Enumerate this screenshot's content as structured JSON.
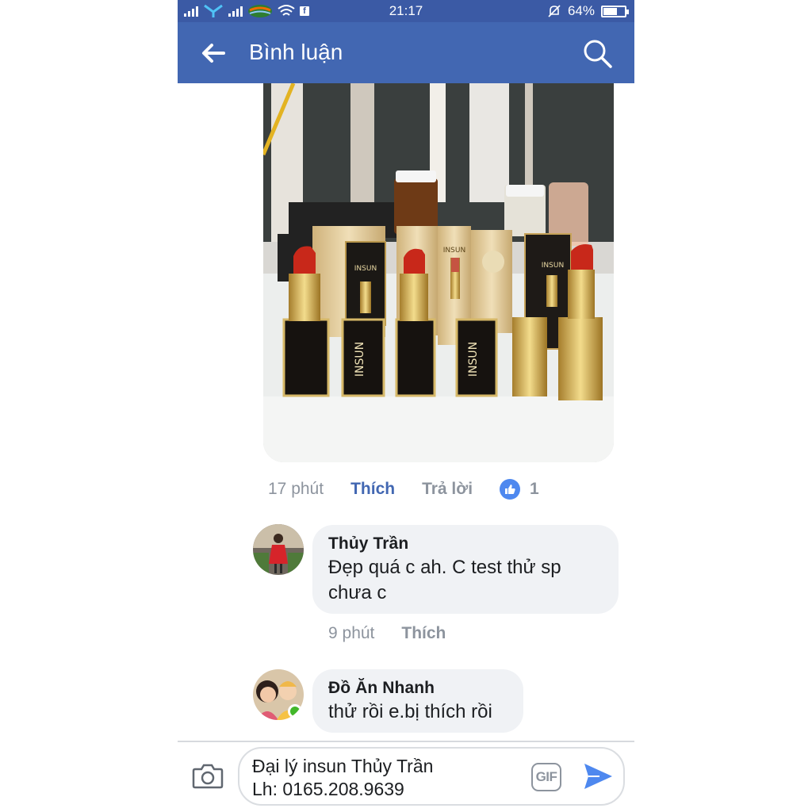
{
  "status_bar": {
    "time": "21:17",
    "battery": "64%"
  },
  "header": {
    "title": "Bình luận"
  },
  "post_actions": {
    "time": "17 phút",
    "like": "Thích",
    "reply": "Trả lời",
    "like_count": "1"
  },
  "comments": [
    {
      "author": "Thủy Trần",
      "line1": "Đẹp quá c ah. C test thử sp",
      "line2": "chưa c",
      "time": "9 phút",
      "like": "Thích"
    },
    {
      "author": "Đồ Ăn Nhanh",
      "line1": "thử rồi e.bị thích rồi"
    }
  ],
  "photo": {
    "brand_text": "INSUN"
  },
  "composer": {
    "line1": "Đại lý insun Thủy Trần",
    "line2": "Lh: 0165.208.9639",
    "gif_label": "GIF"
  },
  "colors": {
    "header": "#4267b2",
    "statusbar": "#3b5aa5",
    "link": "#4267b2",
    "bubble": "#f0f2f5"
  }
}
